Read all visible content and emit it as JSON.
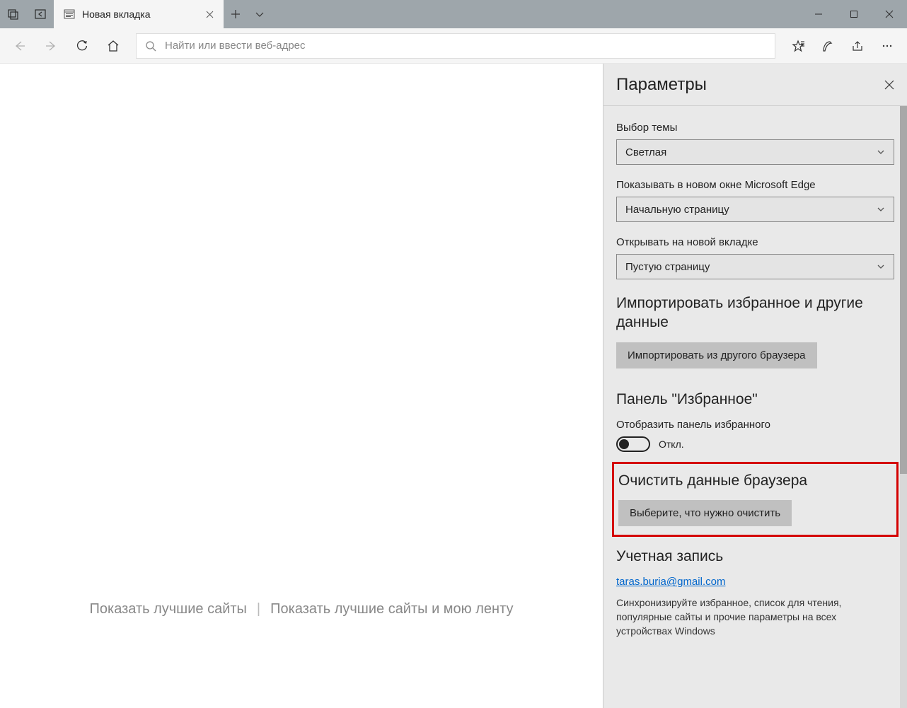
{
  "tab": {
    "title": "Новая вкладка"
  },
  "address_bar": {
    "placeholder": "Найти или ввести веб-адрес"
  },
  "page": {
    "show_top_sites": "Показать лучшие сайты",
    "show_top_sites_feed": "Показать лучшие сайты и мою ленту"
  },
  "settings": {
    "title": "Параметры",
    "theme_label": "Выбор темы",
    "theme_value": "Светлая",
    "new_window_label": "Показывать в новом окне Microsoft Edge",
    "new_window_value": "Начальную страницу",
    "new_tab_label": "Открывать на новой вкладке",
    "new_tab_value": "Пустую страницу",
    "import_heading": "Импортировать избранное и другие данные",
    "import_button": "Импортировать из другого браузера",
    "fav_panel_heading": "Панель \"Избранное\"",
    "fav_toggle_label": "Отобразить панель избранного",
    "fav_toggle_state": "Откл.",
    "clear_heading": "Очистить данные браузера",
    "clear_button": "Выберите, что нужно очистить",
    "account_heading": "Учетная запись",
    "account_email": "taras.buria@gmail.com",
    "account_desc": "Синхронизируйте избранное, список для чтения, популярные сайты и прочие параметры на всех устройствах Windows"
  }
}
